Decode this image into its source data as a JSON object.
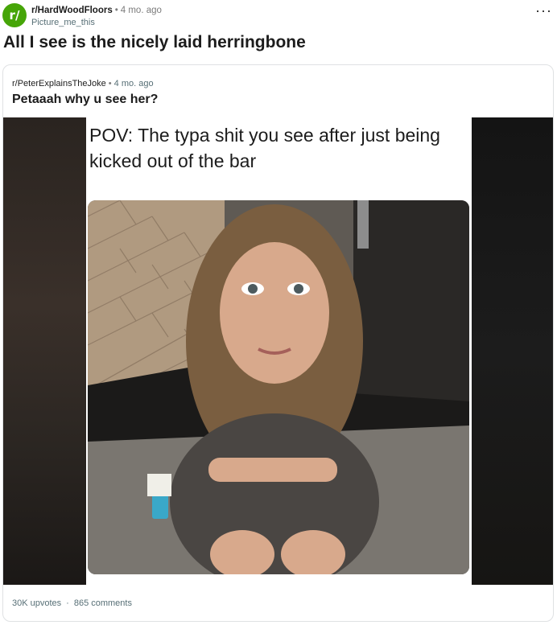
{
  "post": {
    "subreddit": "r/HardWoodFloors",
    "subreddit_icon": "r/",
    "time": "4 mo. ago",
    "username": "Picture_me_this",
    "title": "All I see is the nicely laid herringbone",
    "more_icon": "more-horizontal-icon"
  },
  "crosspost": {
    "subreddit": "r/PeterExplainsTheJoke",
    "time": "4 mo. ago",
    "title": "Petaaah why u see her?",
    "meme_caption": "POV: The typa shit you see after just being kicked out of the bar",
    "upvotes": "30K upvotes",
    "comments": "865 comments"
  },
  "colors": {
    "subreddit_icon_bg": "#46a508",
    "meta_text": "#576f76",
    "card_border": "#dfe1e3"
  }
}
